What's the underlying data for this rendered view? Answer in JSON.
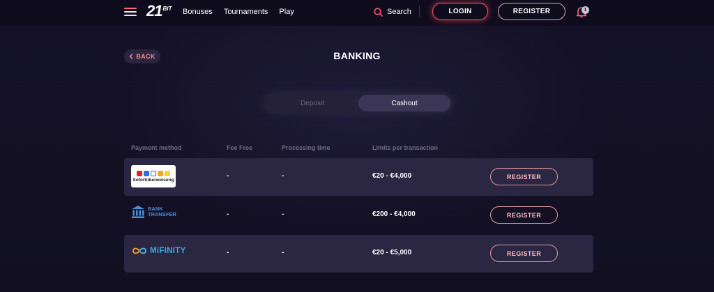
{
  "header": {
    "logo_number": "21",
    "logo_suffix": "BIT",
    "nav": [
      "Bonuses",
      "Tournaments",
      "Play"
    ],
    "search_label": "Search",
    "login_label": "LOGIN",
    "register_label": "REGISTER",
    "notification_count": "1"
  },
  "page": {
    "back_label": "BACK",
    "title": "BANKING"
  },
  "tabs": {
    "deposit": "Deposit",
    "cashout": "Cashout",
    "active": "cashout"
  },
  "table": {
    "headers": {
      "method": "Payment method",
      "fee": "Fee Free",
      "processing": "Processing time",
      "limits": "Limits per transaction"
    },
    "rows": [
      {
        "method_icon": "sofort-logo",
        "logo_text": "Sofortüberweisung",
        "fee": "-",
        "processing": "-",
        "limits": "€20 - €4,000",
        "action": "REGISTER",
        "shaded": true
      },
      {
        "method_icon": "bank-transfer-logo",
        "logo_text_line1": "BANK",
        "logo_text_line2": "TRANSFER",
        "fee": "-",
        "processing": "-",
        "limits": "€200 - €4,000",
        "action": "REGISTER",
        "shaded": false
      },
      {
        "method_icon": "mifinity-logo",
        "logo_text": "MiFINITY",
        "fee": "-",
        "processing": "-",
        "limits": "€20 - €5,000",
        "action": "REGISTER",
        "shaded": true
      }
    ]
  },
  "colors": {
    "background": "#120f22",
    "accent": "#ff5c6e",
    "row_shade": "#2b2742"
  }
}
